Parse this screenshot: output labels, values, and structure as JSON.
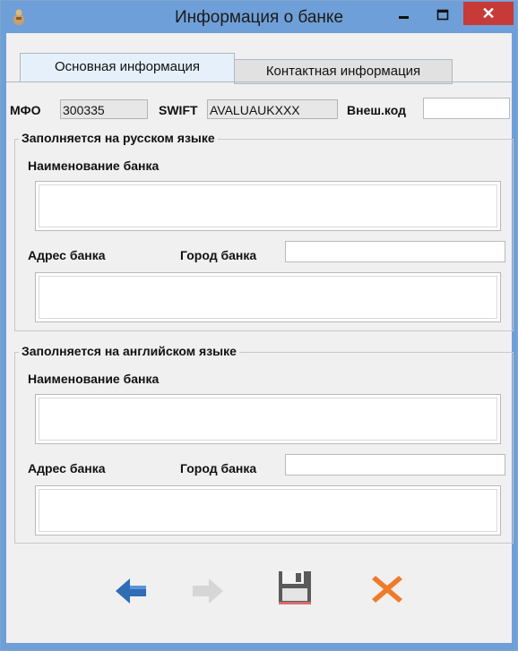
{
  "window": {
    "title": "Информация о банке",
    "accent_color": "#6f9fd8",
    "close_color": "#c73a37"
  },
  "tabs": [
    {
      "label": "Основная информация",
      "active": true
    },
    {
      "label": "Контактная информация",
      "active": false
    }
  ],
  "codes": {
    "mfo_label": "МФО",
    "mfo_value": "300335",
    "swift_label": "SWIFT",
    "swift_value": "AVALUAUKXXX",
    "ext_label": "Внеш.код",
    "ext_value": ""
  },
  "russian": {
    "legend": "Заполняется на русском языке",
    "name_label": "Наименование банка",
    "name_value": "",
    "address_label": "Адрес банка",
    "city_label": "Город банка",
    "city_value": "",
    "address_value": ""
  },
  "english": {
    "legend": "Заполняется на английском языке",
    "name_label": "Наименование банка",
    "name_value": "",
    "address_label": "Адрес банка",
    "city_label": "Город банка",
    "city_value": "",
    "address_value": ""
  },
  "toolbar": {
    "back_icon": "arrow-left-icon",
    "forward_icon": "arrow-right-icon",
    "save_icon": "floppy-disk-icon",
    "cancel_icon": "close-x-icon",
    "back_color": "#2f6db5",
    "cancel_color": "#f07a2a"
  }
}
